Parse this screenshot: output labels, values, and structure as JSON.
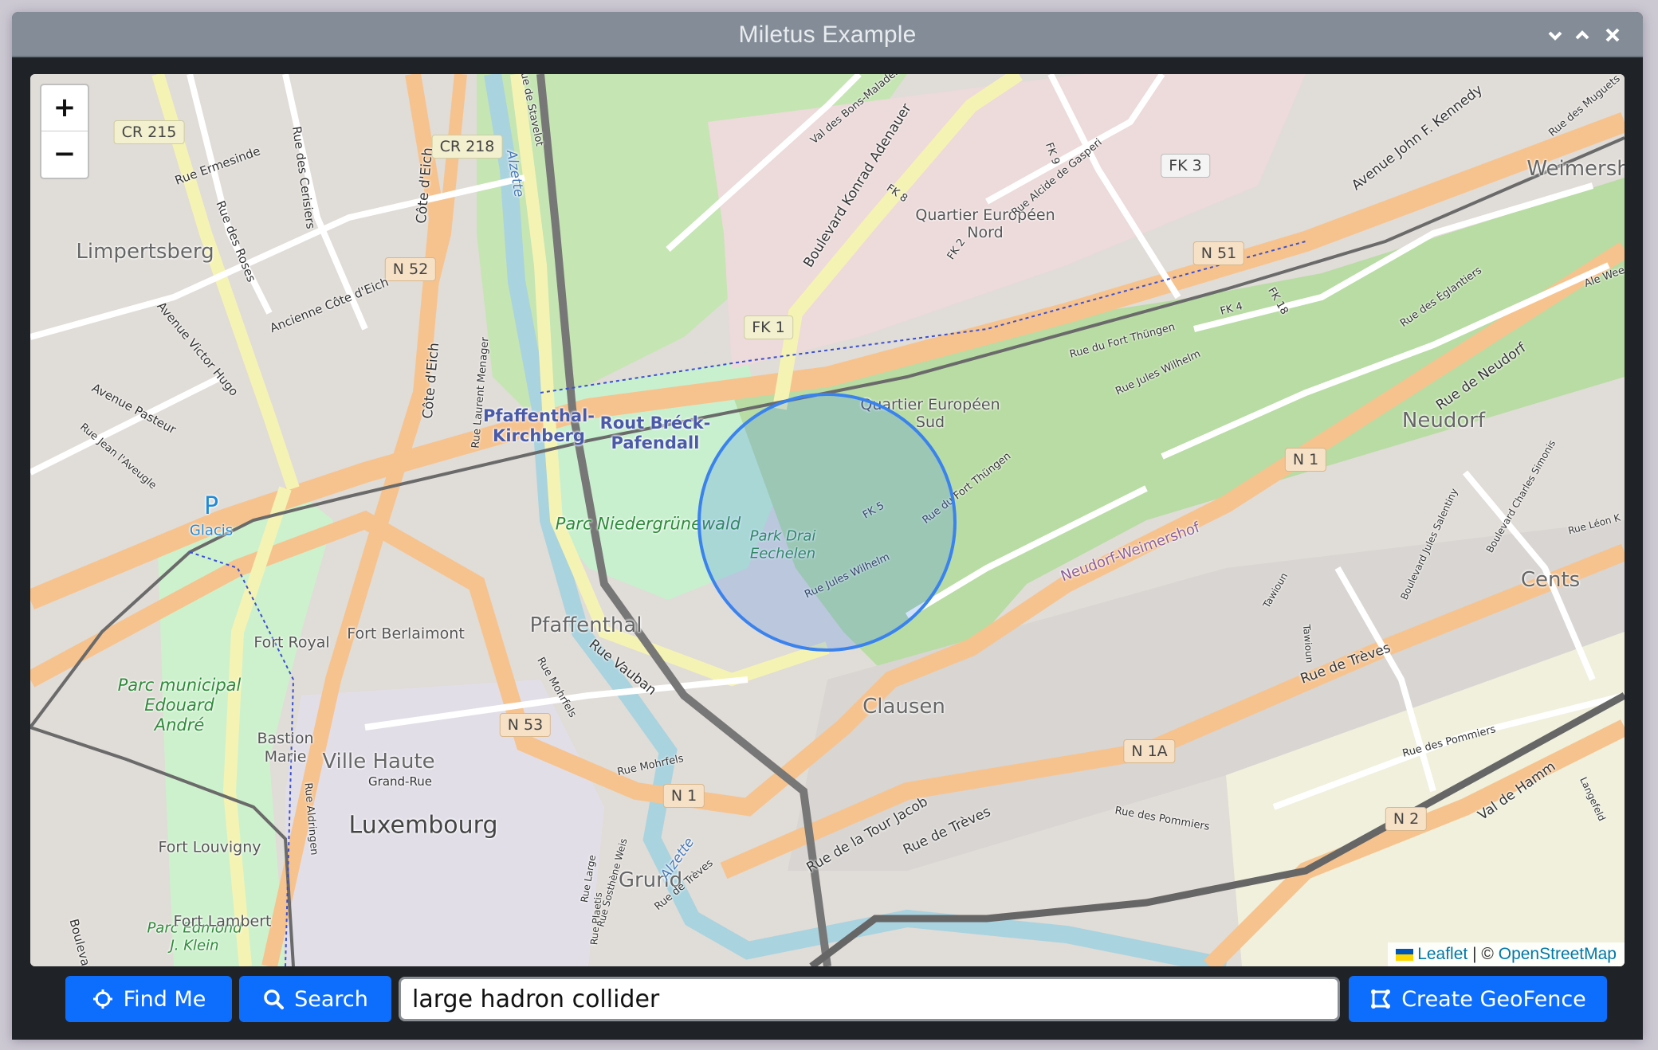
{
  "window": {
    "title": "Miletus Example",
    "controls": [
      "minimize",
      "maximize",
      "close"
    ]
  },
  "map": {
    "zoom_in_label": "+",
    "zoom_out_label": "−",
    "attribution": {
      "leaflet": "Leaflet",
      "separator": "|",
      "copyright": "©",
      "osm": "OpenStreetMap"
    },
    "geofence_circle": {
      "color": "#3a82ee",
      "fill": "rgba(56,128,240,0.22)"
    },
    "places": {
      "limpertsberg": "Limpertsberg",
      "quartier_nord": "Quartier Européen\nNord",
      "quartier_sud": "Quartier Européen\nSud",
      "weimershof": "Weimersho",
      "neudorf": "Neudorf",
      "cents": "Cents",
      "pfaffenthal": "Pfaffenthal",
      "clausen": "Clausen",
      "ville_haute": "Ville Haute",
      "grand_rue": "Grand-Rue",
      "luxembourg": "Luxembourg",
      "grund": "Grund",
      "neudorf_weimershof": "Neudorf-Weimershof"
    },
    "stations": {
      "pfaffenthal_kirchberg": "Pfaffenthal-\nKirchberg",
      "rout_breck": "Rout Bréck-\nPafendall"
    },
    "parks": {
      "niedergrunewald": "Parc Niedergrünewald",
      "drai_eechelen": "Park Drai\nEechelen",
      "edouard_andre": "Parc municipal\nEdouard\nAndré",
      "edmond_klein": "Parc Edmond\nJ. Klein"
    },
    "forts": {
      "royal": "Fort Royal",
      "berlaimont": "Fort Berlaimont",
      "bastion_marie": "Bastion\nMarie",
      "louvigny": "Fort Louvigny",
      "lambert": "Fort Lambert"
    },
    "parking": {
      "symbol": "P",
      "name": "Glacis"
    },
    "shields": {
      "cr215": "CR 215",
      "cr218": "CR 218",
      "n52": "N 52",
      "fk1": "FK 1",
      "fk3": "FK 3",
      "n51": "N 51",
      "n1_east": "N 1",
      "n53": "N 53",
      "n1a": "N 1A",
      "n1_south": "N 1",
      "n2": "N 2"
    },
    "streets": {
      "rue_ermesinde": "Rue Ermesinde",
      "rue_des_roses": "Rue des Roses",
      "rue_des_cerisiers": "Rue des Cerisiers",
      "cote_deich": "Côte d'Eich",
      "ancienne_cote": "Ancienne Côte d'Eich",
      "avenue_victor_hugo": "Avenue Victor Hugo",
      "avenue_pasteur": "Avenue Pasteur",
      "rue_jean_laveugle": "Rue Jean l'Aveugle",
      "rue_laurent_menager": "Rue Laurent Menager",
      "alzette": "Alzette",
      "rue_de_stavelot": "Rue de Stavelot",
      "val_des_bons_malades": "Val des Bons-Malades",
      "boulevard_adenauer": "Boulevard Konrad Adenauer",
      "fk8": "FK 8",
      "fk9": "FK 9",
      "fk2": "FK 2",
      "rue_alcide": "Rue Alcide de Gasperi",
      "avenue_kennedy": "Avenue John F. Kennedy",
      "rue_des_muguets": "Rue des Muguets",
      "rue_des_eglantiers": "Rue des Églantiers",
      "rue_du_fort_thungen": "Rue du Fort Thüngen",
      "rue_jules_wilhelm": "Rue Jules Wilhelm",
      "rue_de_neudorf": "Rue de Neudorf",
      "fk4": "FK 4",
      "fk5": "FK 5",
      "fk18": "FK 18",
      "rue_vauban": "Rue Vauban",
      "rue_mohrfels": "Rue Mohrfels",
      "rue_de_treves": "Rue de Trèves",
      "rue_tour_jacob": "Rue de la Tour Jacob",
      "rue_des_pommiers": "Rue des Pommiers",
      "val_de_hamm": "Val de Hamm",
      "langefeld": "Langefeld",
      "tawioun": "Tawioun",
      "bd_jules_salentiny": "Boulevard Jules Salentiny",
      "bd_charles_simonis": "Boulevard Charles Simonis",
      "rue_leon_kauffman": "Rue Léon K",
      "rue_aldringen": "Rue Aldringen",
      "rue_large": "Rue Large",
      "rue_sosthene_weis": "Rue Sosthène Weis",
      "rue_plaetis": "Rue Plaetis",
      "boulevard": "Bouleva",
      "ale_weg": "Ale Wee"
    }
  },
  "toolbar": {
    "find_me_label": "Find Me",
    "search_label": "Search",
    "search_value": "large hadron collider",
    "create_geofence_label": "Create GeoFence",
    "accent_color": "#0d6efd"
  }
}
